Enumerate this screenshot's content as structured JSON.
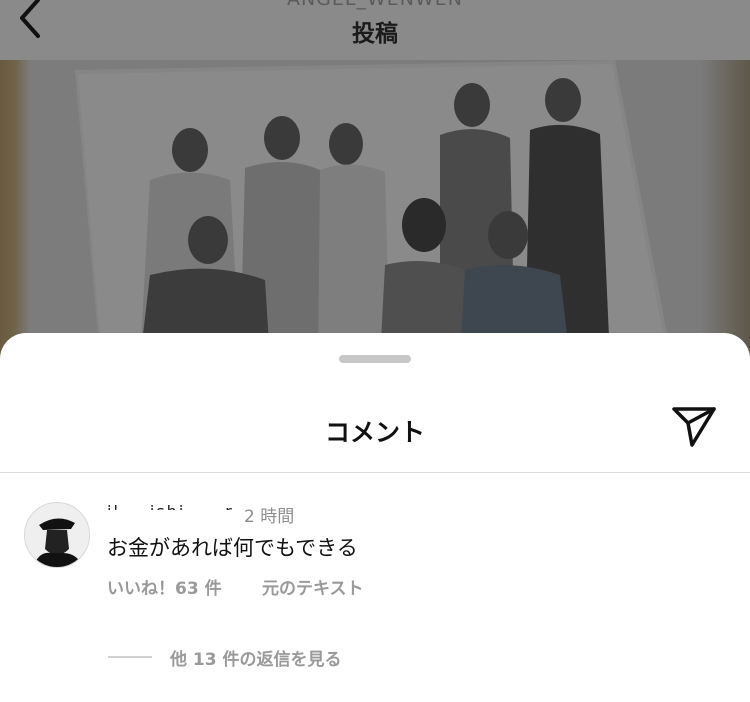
{
  "header": {
    "username": "ANGEL_WENWEN",
    "title": "投稿"
  },
  "sheet": {
    "title": "コメント"
  },
  "comment": {
    "username": "il___ishi____r",
    "time": "2 時間",
    "text": "お金があれば何でもできる",
    "likes": "いいね！63 件",
    "translate": "元のテキスト",
    "replies": "他 13 件の返信を見る"
  },
  "colors": {
    "overlay": "#7b7b7b",
    "sheet_bg": "#ffffff",
    "muted_text": "#9a9a9a"
  },
  "icons": {
    "back": "chevron-left-icon",
    "send": "paper-plane-icon"
  }
}
